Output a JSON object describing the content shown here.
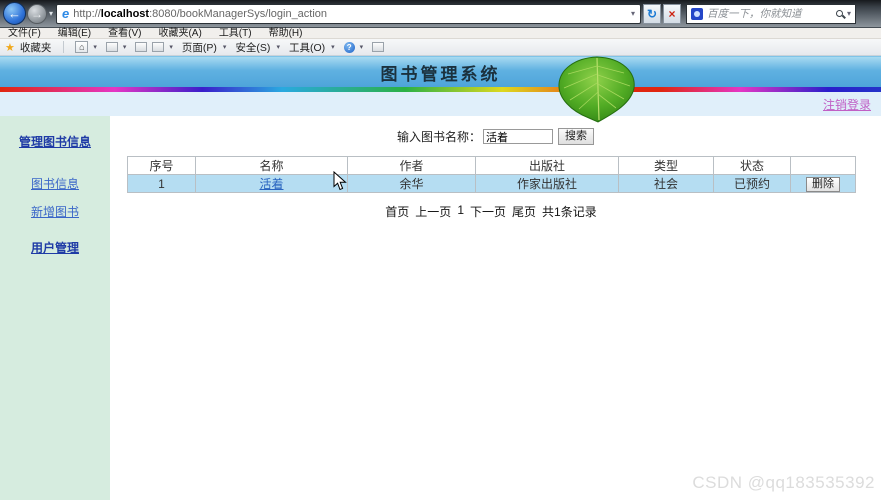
{
  "browser": {
    "url": {
      "scheme": "http://",
      "host": "localhost",
      "path": ":8080/bookManagerSys/login_action"
    },
    "menu": [
      "文件(F)",
      "编辑(E)",
      "查看(V)",
      "收藏夹(A)",
      "工具(T)",
      "帮助(H)"
    ],
    "favorites_label": "收藏夹",
    "toolbar": {
      "page": "页面(P)",
      "security": "安全(S)",
      "tools": "工具(O)",
      "help": "?"
    },
    "web_search_placeholder": "百度一下，你就知道"
  },
  "header": {
    "title": "图书管理系统",
    "logout": "注销登录"
  },
  "sidebar": {
    "heading_books": "管理图书信息",
    "link_book_info": "图书信息",
    "link_add_book": "新增图书",
    "heading_users": "用户管理"
  },
  "search": {
    "label": "输入图书名称：",
    "value": "活着",
    "button": "搜索"
  },
  "table": {
    "columns": [
      "序号",
      "名称",
      "作者",
      "出版社",
      "类型",
      "状态",
      ""
    ],
    "rows": [
      {
        "seq": "1",
        "name": "活着",
        "author": "余华",
        "publisher": "作家出版社",
        "type": "社会",
        "status": "已预约",
        "action": "删除"
      }
    ]
  },
  "pagination": {
    "first": "首页",
    "prev": "上一页",
    "current": "1",
    "next": "下一页",
    "last": "尾页",
    "total": "共1条记录"
  },
  "watermark": "CSDN @qq183535392",
  "colors": {
    "banner_blue": "#5fb1e1",
    "sidebar_green": "#d6ecdf",
    "row_highlight": "#b5ddf2",
    "link_blue": "#2a65c0",
    "logout_purple": "#c05fc5"
  }
}
